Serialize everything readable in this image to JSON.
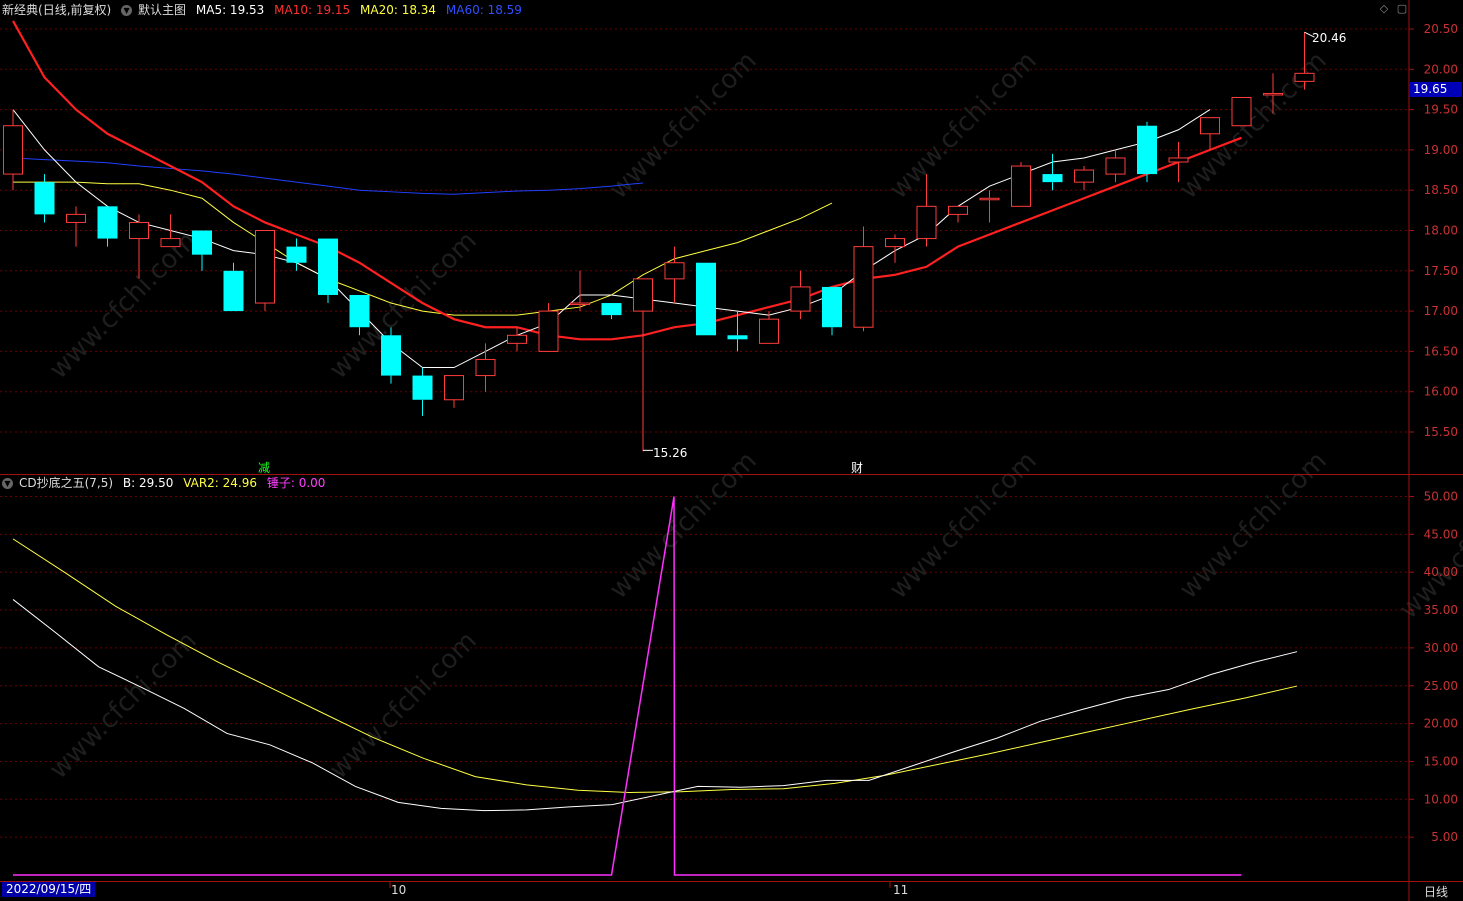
{
  "main_panel": {
    "stock_name": "新经典",
    "period_desc": "(日线,前复权)",
    "template_name": "默认主图",
    "ma5": "MA5: 19.53",
    "ma10": "MA10: 19.15",
    "ma20": "MA20: 18.34",
    "ma60": "MA60: 18.59",
    "last_price_tag": "19.65",
    "high_label": "20.46",
    "low_label": "15.26",
    "marker_jian": "减",
    "marker_cai": "财"
  },
  "sub_panel": {
    "indicator": "CD抄底之五(7,5)",
    "b_value": "B: 29.50",
    "var2_value": "VAR2: 24.96",
    "hammer_value": "锤子: 0.00"
  },
  "bottom_bar": {
    "date": "2022/09/15/四",
    "month_10": "10",
    "month_11": "11",
    "period": "日线"
  },
  "colors": {
    "up": "#ff3c3c",
    "down": "#00ffff",
    "ma5": "#ffffff",
    "ma10": "#ff2020",
    "ma20": "#ffff40",
    "ma60": "#2040ff",
    "magenta": "#ff30ff",
    "grid": "#6a0000",
    "axis_text": "#c83232"
  },
  "chart_data": [
    {
      "type": "candlestick",
      "title": "新经典 (日线,前复权)",
      "y_ticks": [
        20.5,
        20.0,
        19.5,
        19.0,
        18.5,
        18.0,
        17.5,
        17.0,
        16.5,
        16.0,
        15.5
      ],
      "y_range": [
        15.2,
        20.7
      ],
      "candles": [
        {
          "o": 18.7,
          "c": 19.3,
          "h": 19.5,
          "l": 18.5
        },
        {
          "o": 18.6,
          "c": 18.2,
          "h": 18.7,
          "l": 18.1
        },
        {
          "o": 18.1,
          "c": 18.2,
          "h": 18.3,
          "l": 17.8
        },
        {
          "o": 18.3,
          "c": 17.9,
          "h": 18.3,
          "l": 17.8
        },
        {
          "o": 17.9,
          "c": 18.1,
          "h": 18.2,
          "l": 17.4
        },
        {
          "o": 17.8,
          "c": 17.9,
          "h": 18.2,
          "l": 17.8
        },
        {
          "o": 18.0,
          "c": 17.7,
          "h": 18.0,
          "l": 17.5
        },
        {
          "o": 17.5,
          "c": 17.0,
          "h": 17.6,
          "l": 17.0
        },
        {
          "o": 17.1,
          "c": 18.0,
          "h": 18.0,
          "l": 17.0
        },
        {
          "o": 17.8,
          "c": 17.6,
          "h": 17.9,
          "l": 17.5
        },
        {
          "o": 17.9,
          "c": 17.2,
          "h": 17.9,
          "l": 17.1
        },
        {
          "o": 17.2,
          "c": 16.8,
          "h": 17.2,
          "l": 16.7
        },
        {
          "o": 16.7,
          "c": 16.2,
          "h": 16.8,
          "l": 16.1
        },
        {
          "o": 16.2,
          "c": 15.9,
          "h": 16.3,
          "l": 15.7
        },
        {
          "o": 15.9,
          "c": 16.2,
          "h": 16.2,
          "l": 15.8
        },
        {
          "o": 16.2,
          "c": 16.4,
          "h": 16.6,
          "l": 16.0
        },
        {
          "o": 16.6,
          "c": 16.7,
          "h": 16.8,
          "l": 16.5
        },
        {
          "o": 16.5,
          "c": 17.0,
          "h": 17.1,
          "l": 16.5
        },
        {
          "o": 17.1,
          "c": 17.1,
          "h": 17.5,
          "l": 17.0
        },
        {
          "o": 17.1,
          "c": 16.95,
          "h": 17.1,
          "l": 16.9
        },
        {
          "o": 17.0,
          "c": 17.4,
          "h": 17.4,
          "l": 15.26
        },
        {
          "o": 17.4,
          "c": 17.6,
          "h": 17.8,
          "l": 17.1
        },
        {
          "o": 17.6,
          "c": 16.7,
          "h": 17.6,
          "l": 16.7
        },
        {
          "o": 16.7,
          "c": 16.65,
          "h": 17.0,
          "l": 16.5
        },
        {
          "o": 16.6,
          "c": 16.9,
          "h": 17.0,
          "l": 16.6
        },
        {
          "o": 17.0,
          "c": 17.3,
          "h": 17.5,
          "l": 16.9
        },
        {
          "o": 17.3,
          "c": 16.8,
          "h": 17.3,
          "l": 16.7
        },
        {
          "o": 16.8,
          "c": 17.8,
          "h": 18.05,
          "l": 16.75
        },
        {
          "o": 17.8,
          "c": 17.9,
          "h": 17.95,
          "l": 17.6
        },
        {
          "o": 17.9,
          "c": 18.3,
          "h": 18.7,
          "l": 17.8
        },
        {
          "o": 18.2,
          "c": 18.3,
          "h": 18.3,
          "l": 18.1
        },
        {
          "o": 18.4,
          "c": 18.4,
          "h": 18.5,
          "l": 18.1
        },
        {
          "o": 18.3,
          "c": 18.8,
          "h": 18.85,
          "l": 18.3
        },
        {
          "o": 18.7,
          "c": 18.6,
          "h": 18.95,
          "l": 18.5
        },
        {
          "o": 18.6,
          "c": 18.75,
          "h": 18.8,
          "l": 18.5
        },
        {
          "o": 18.7,
          "c": 18.9,
          "h": 19.0,
          "l": 18.6
        },
        {
          "o": 19.3,
          "c": 18.7,
          "h": 19.35,
          "l": 18.6
        },
        {
          "o": 18.85,
          "c": 18.9,
          "h": 19.1,
          "l": 18.6
        },
        {
          "o": 19.2,
          "c": 19.4,
          "h": 19.4,
          "l": 19.0
        },
        {
          "o": 19.3,
          "c": 19.65,
          "h": 19.65,
          "l": 19.3
        },
        {
          "o": 19.7,
          "c": 19.7,
          "h": 19.95,
          "l": 19.45
        },
        {
          "o": 19.85,
          "c": 19.95,
          "h": 20.46,
          "l": 19.75
        }
      ],
      "ma5": [
        19.5,
        19.0,
        18.6,
        18.3,
        18.1,
        18.0,
        17.9,
        17.75,
        17.7,
        17.6,
        17.4,
        17.0,
        16.6,
        16.3,
        16.3,
        16.5,
        16.7,
        16.85,
        17.2,
        17.2,
        17.15,
        17.1,
        17.05,
        17.0,
        16.95,
        17.05,
        17.2,
        17.5,
        17.75,
        17.95,
        18.3,
        18.55,
        18.7,
        18.85,
        18.9,
        19.0,
        19.1,
        19.25,
        19.5
      ],
      "ma10": [
        20.6,
        19.9,
        19.5,
        19.2,
        19.0,
        18.8,
        18.6,
        18.3,
        18.1,
        17.95,
        17.8,
        17.6,
        17.35,
        17.1,
        16.9,
        16.8,
        16.8,
        16.7,
        16.65,
        16.65,
        16.7,
        16.8,
        16.85,
        16.95,
        17.05,
        17.15,
        17.3,
        17.4,
        17.45,
        17.55,
        17.8,
        17.95,
        18.1,
        18.25,
        18.4,
        18.55,
        18.7,
        18.85,
        19.0,
        19.15
      ],
      "ma20": [
        18.6,
        18.6,
        18.6,
        18.58,
        18.58,
        18.5,
        18.4,
        18.1,
        17.85,
        17.6,
        17.4,
        17.25,
        17.1,
        17.0,
        16.95,
        16.95,
        16.95,
        17.0,
        17.05,
        17.2,
        17.45,
        17.65,
        17.75,
        17.85,
        18.0,
        18.15,
        18.34
      ],
      "ma60": [
        18.9,
        18.88,
        18.86,
        18.84,
        18.8,
        18.77,
        18.74,
        18.7,
        18.65,
        18.6,
        18.55,
        18.5,
        18.48,
        18.46,
        18.45,
        18.47,
        18.49,
        18.5,
        18.52,
        18.55,
        18.59
      ]
    },
    {
      "type": "line",
      "title": "CD抄底之五(7,5)",
      "y_ticks": [
        50,
        45,
        40,
        35,
        30,
        25,
        20,
        15,
        10,
        5
      ],
      "y_range": [
        0,
        52
      ],
      "series": [
        {
          "name": "B",
          "values": [
            36.4,
            32.0,
            27.5,
            24.8,
            22.0,
            18.7,
            17.2,
            14.8,
            11.7,
            9.6,
            8.8,
            8.5,
            8.6,
            9.0,
            9.3,
            10.5,
            11.7,
            11.6,
            11.8,
            12.5,
            12.5,
            14.4,
            16.3,
            18.1,
            20.3,
            21.9,
            23.4,
            24.5,
            26.5,
            28.1,
            29.5
          ]
        },
        {
          "name": "VAR2",
          "values": [
            44.4,
            40.0,
            35.5,
            31.7,
            28.1,
            24.8,
            21.5,
            18.2,
            15.4,
            13.0,
            11.9,
            11.2,
            10.9,
            11.0,
            11.3,
            11.4,
            12.1,
            13.2,
            14.6,
            16.0,
            17.5,
            19.0,
            20.5,
            22.0,
            23.4,
            24.96
          ]
        },
        {
          "name": "锤子",
          "values": [
            0,
            0,
            0,
            0,
            0,
            0,
            0,
            0,
            0,
            0,
            0,
            0,
            0,
            0,
            0,
            0,
            0,
            0,
            0,
            0,
            50,
            0,
            0,
            0,
            0,
            0,
            0,
            0,
            0,
            0,
            0,
            0,
            0,
            0,
            0,
            0,
            0,
            0,
            0,
            0
          ]
        }
      ]
    }
  ]
}
